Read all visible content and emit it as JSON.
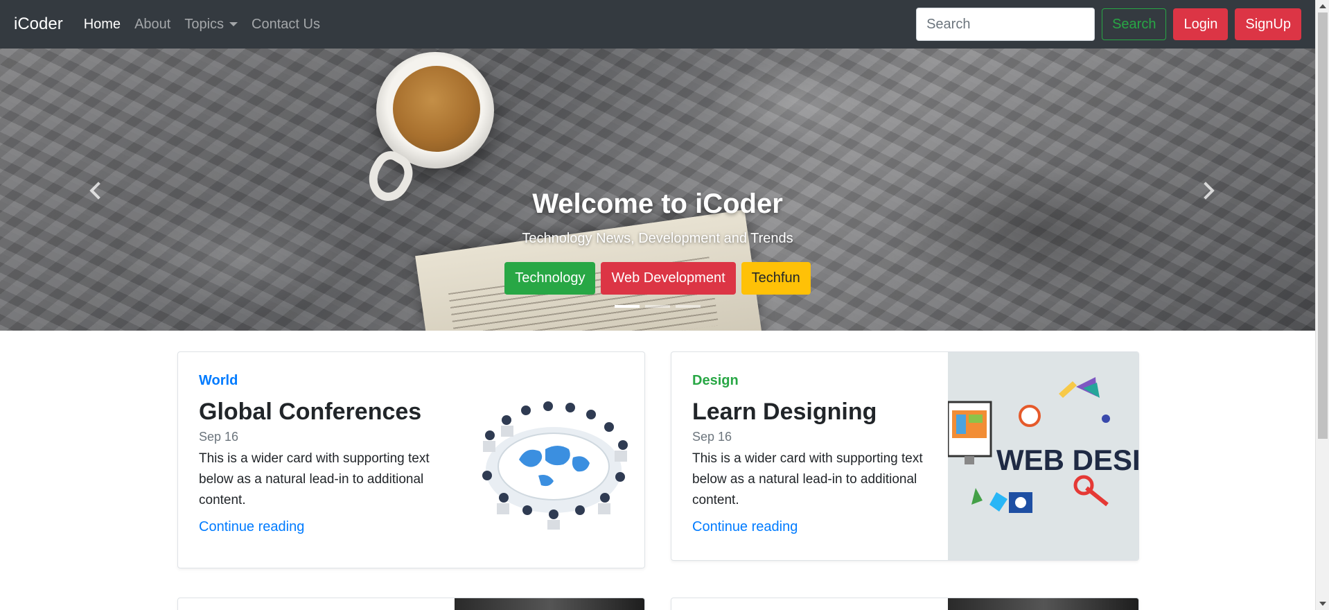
{
  "navbar": {
    "brand": "iCoder",
    "links": [
      {
        "label": "Home",
        "active": true
      },
      {
        "label": "About",
        "active": false
      },
      {
        "label": "Topics",
        "active": false,
        "dropdown": true
      },
      {
        "label": "Contact Us",
        "active": false
      }
    ],
    "search_placeholder": "Search",
    "search_button": "Search",
    "login_button": "Login",
    "signup_button": "SignUp"
  },
  "carousel": {
    "title": "Welcome to iCoder",
    "subtitle": "Technology News, Development and Trends",
    "buttons": [
      {
        "label": "Technology",
        "color": "#28a745"
      },
      {
        "label": "Web Development",
        "color": "#dc3545"
      },
      {
        "label": "Techfun",
        "color": "#ffc107"
      }
    ],
    "active_slide": 1,
    "slide_count": 3
  },
  "cards": [
    {
      "category": "World",
      "title": "Global Conferences",
      "date": "Sep 16",
      "text": "This is a wider card with supporting text below as a natural lead-in to additional content.",
      "link": "Continue reading",
      "image_icon": "conference-table-icon"
    },
    {
      "category": "Design",
      "title": "Learn Designing",
      "date": "Sep 16",
      "text": "This is a wider card with supporting text below as a natural lead-in to additional content.",
      "link": "Continue reading",
      "image_label": "WEB DESIGN",
      "image_icon": "web-design-icon"
    }
  ],
  "colors": {
    "navbar_bg": "#343a40",
    "primary": "#007bff",
    "success": "#28a745",
    "danger": "#dc3545",
    "warning": "#ffc107"
  }
}
